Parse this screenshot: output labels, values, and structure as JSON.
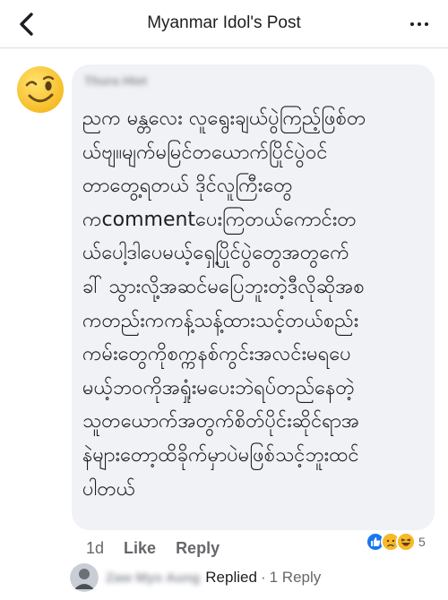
{
  "header": {
    "title": "Myanmar Idol's Post",
    "back_icon": "chevron-left-icon",
    "more_icon": "more-horizontal-icon"
  },
  "comment": {
    "author": "Thura Htet",
    "avatar_icon": "winking-face-emoji",
    "lines": [
      "ညက မန္တလေး လူရွေးချယ်ပွဲကြည့်ဖြစ်တ",
      "ယ်ဗျ။မျက်မမြင်တယောက်ပြိုင်ပွဲဝင်",
      "တာတွေ့ရတယ် ဒိုင်လူကြီးတွေ",
      "ကcommentပေးကြတယ်ကောင်းတ",
      "ယ်ပေါ့ဒါပေမယ့်ရှေ့ပြိုင်ပွဲတွေအတွက်ေ",
      "ခါ် သွားလို့အဆင်မပြေဘူးတဲ့ဒီလိုဆိုအစ",
      "ကတည်းကကန့်သန့်ထားသင့်တယ်စည်း",
      "ကမ်းတွေကိုစက္ကနစ်ကွင်းအလင်းမရပေ",
      "မယ့်ဘဝကိုအရှုံးမပေးဘဲရပ်တည်နေတဲ့",
      "သူတယောက်အတွက်စိတ်ပိုင်းဆိုင်ရာအ",
      "နဲများတော့ထိခိုက်မှာပဲမဖြစ်သင့်ဘူးထင်",
      "ပါတယ်"
    ],
    "time": "1d",
    "like_label": "Like",
    "reply_label": "Reply",
    "reactions": [
      "like-reaction-icon",
      "sad-reaction-icon",
      "haha-reaction-icon"
    ],
    "reaction_count": "5"
  },
  "reply_summary": {
    "replier_name": "Zaw Myo Aung",
    "replied_label": "Replied",
    "separator": "·",
    "count_label": "1 Reply"
  },
  "colors": {
    "bubble": "#f0f2f5",
    "muted_text": "#65676b",
    "like_blue": "#1877f2",
    "emoji_yellow": "#f7b928"
  }
}
